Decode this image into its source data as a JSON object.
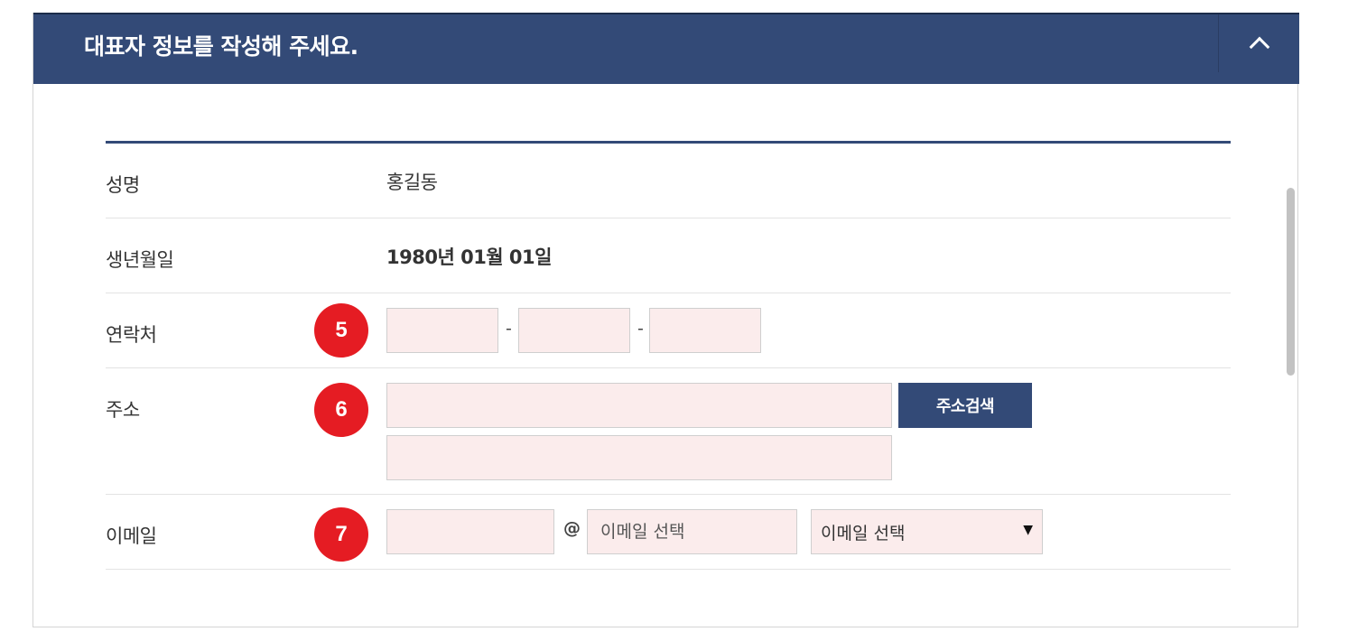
{
  "panel": {
    "title": "대표자 정보를 작성해 주세요.",
    "collapse_icon": "chevron-up-icon"
  },
  "form": {
    "name": {
      "label": "성명",
      "value": "홍길동"
    },
    "birthdate": {
      "label": "생년월일",
      "value": "1980년 01월 01일"
    },
    "phone": {
      "label": "연락처",
      "step": "5",
      "separator": "-",
      "fields": [
        "",
        "",
        ""
      ]
    },
    "address": {
      "label": "주소",
      "step": "6",
      "line1": "",
      "line2": "",
      "search_button": "주소검색"
    },
    "email": {
      "label": "이메일",
      "step": "7",
      "local": "",
      "at": "@",
      "domain_placeholder": "이메일 선택",
      "select_value": "이메일 선택",
      "select_arrow": "▼"
    }
  },
  "colors": {
    "header": "#334a77",
    "input_bg": "#fbecec",
    "step_badge": "#e51c23"
  }
}
